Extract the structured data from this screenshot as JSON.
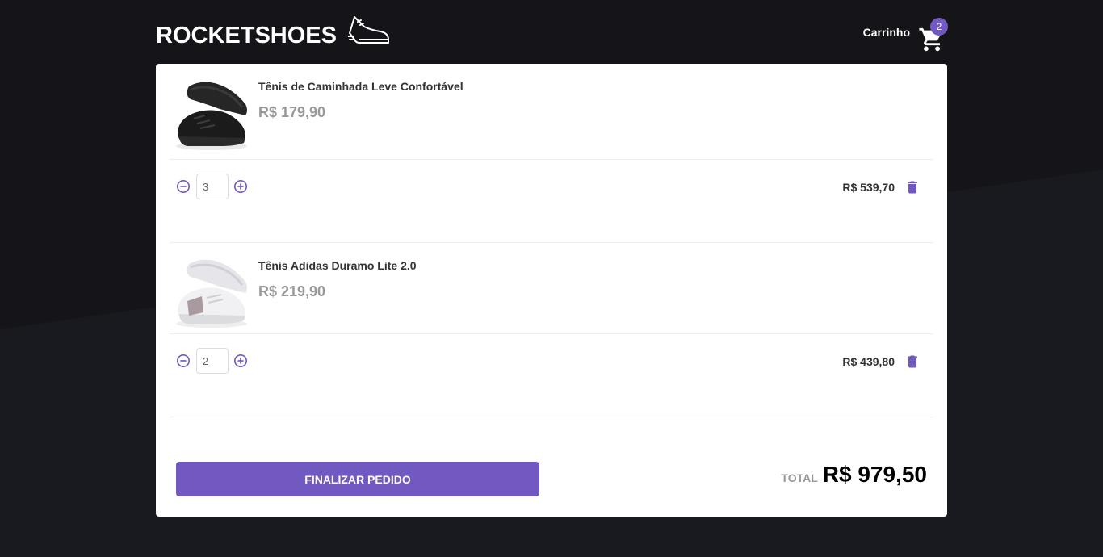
{
  "header": {
    "logo_text": "ROCKETSHOES",
    "logo_icon": "sneaker-icon",
    "cart_label": "Carrinho",
    "cart_count": "2",
    "cart_icon": "cart-icon"
  },
  "cart": {
    "items": [
      {
        "title": "Tênis de Caminhada Leve Confortável",
        "price": "R$ 179,90",
        "quantity": "3",
        "subtotal": "R$ 539,70",
        "image": "black-sneaker-image"
      },
      {
        "title": "Tênis Adidas Duramo Lite 2.0",
        "price": "R$ 219,90",
        "quantity": "2",
        "subtotal": "R$ 439,80",
        "image": "white-sneaker-image"
      }
    ],
    "checkout_label": "FINALIZAR PEDIDO",
    "total_label": "TOTAL",
    "total_value": "R$ 979,50"
  },
  "colors": {
    "background": "#191920",
    "accent": "#7159c1",
    "panel": "#ffffff"
  }
}
